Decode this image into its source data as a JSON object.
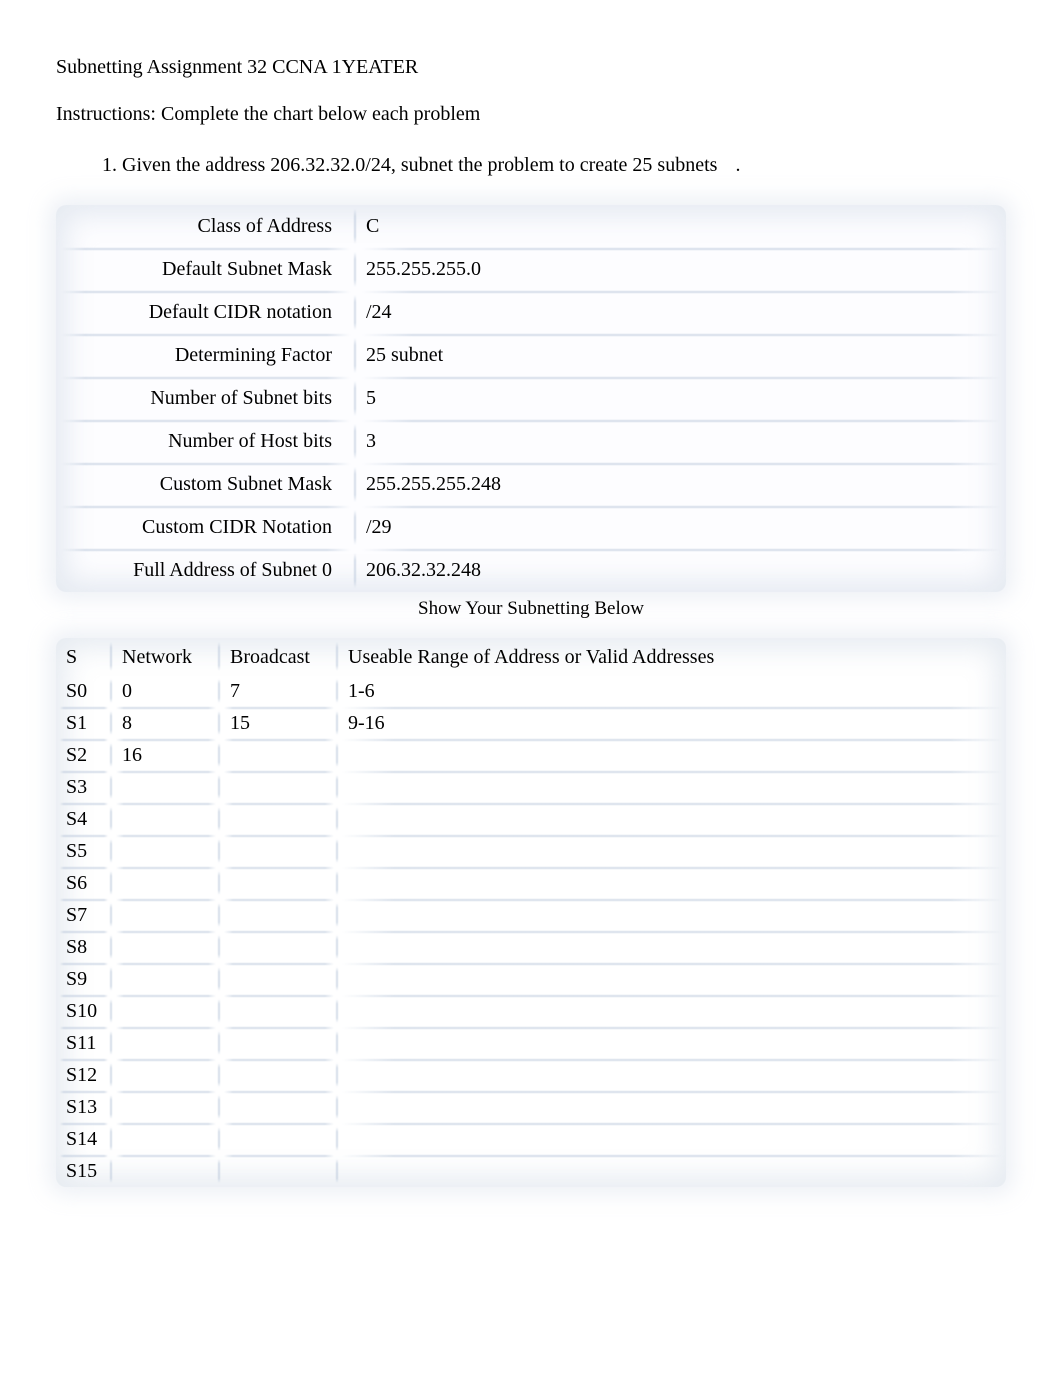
{
  "header": {
    "title": "Subnetting Assignment 32 CCNA 1YEATER",
    "instructions": "Instructions: Complete the chart below each problem",
    "problem_number": "1.",
    "problem_text": "Given the address 206.32.32.0/24, subnet the problem to create 25 subnets",
    "problem_period": "."
  },
  "info_rows": [
    {
      "label": "Class of Address",
      "value": "C"
    },
    {
      "label": "Default Subnet Mask",
      "value": "255.255.255.0"
    },
    {
      "label": "Default CIDR notation",
      "value": "/24"
    },
    {
      "label": "Determining Factor",
      "value": "25 subnet"
    },
    {
      "label": "Number of Subnet bits",
      "value": "5"
    },
    {
      "label": "Number of Host bits",
      "value": "3"
    },
    {
      "label": "Custom Subnet Mask",
      "value": "255.255.255.248"
    },
    {
      "label": "Custom CIDR Notation",
      "value": "/29"
    },
    {
      "label": "Full Address of Subnet 0",
      "value": "206.32.32.248"
    }
  ],
  "show_caption": "Show Your Subnetting Below",
  "subnet_headers": {
    "s": "S",
    "network": "Network",
    "broadcast": "Broadcast",
    "range": "Useable Range of Address or Valid Addresses"
  },
  "subnet_rows": [
    {
      "s": "S0",
      "network": "0",
      "broadcast": "7",
      "range": "1-6"
    },
    {
      "s": "S1",
      "network": "8",
      "broadcast": "15",
      "range": "9-16"
    },
    {
      "s": "S2",
      "network": "16",
      "broadcast": "",
      "range": ""
    },
    {
      "s": "S3",
      "network": "",
      "broadcast": "",
      "range": ""
    },
    {
      "s": "S4",
      "network": "",
      "broadcast": "",
      "range": ""
    },
    {
      "s": "S5",
      "network": "",
      "broadcast": "",
      "range": ""
    },
    {
      "s": "S6",
      "network": "",
      "broadcast": "",
      "range": ""
    },
    {
      "s": "S7",
      "network": "",
      "broadcast": "",
      "range": ""
    },
    {
      "s": "S8",
      "network": "",
      "broadcast": "",
      "range": ""
    },
    {
      "s": "S9",
      "network": "",
      "broadcast": "",
      "range": ""
    },
    {
      "s": "S10",
      "network": "",
      "broadcast": "",
      "range": ""
    },
    {
      "s": "S11",
      "network": "",
      "broadcast": "",
      "range": ""
    },
    {
      "s": "S12",
      "network": "",
      "broadcast": "",
      "range": ""
    },
    {
      "s": "S13",
      "network": "",
      "broadcast": "",
      "range": ""
    },
    {
      "s": "S14",
      "network": "",
      "broadcast": "",
      "range": ""
    },
    {
      "s": "S15",
      "network": "",
      "broadcast": "",
      "range": ""
    }
  ]
}
